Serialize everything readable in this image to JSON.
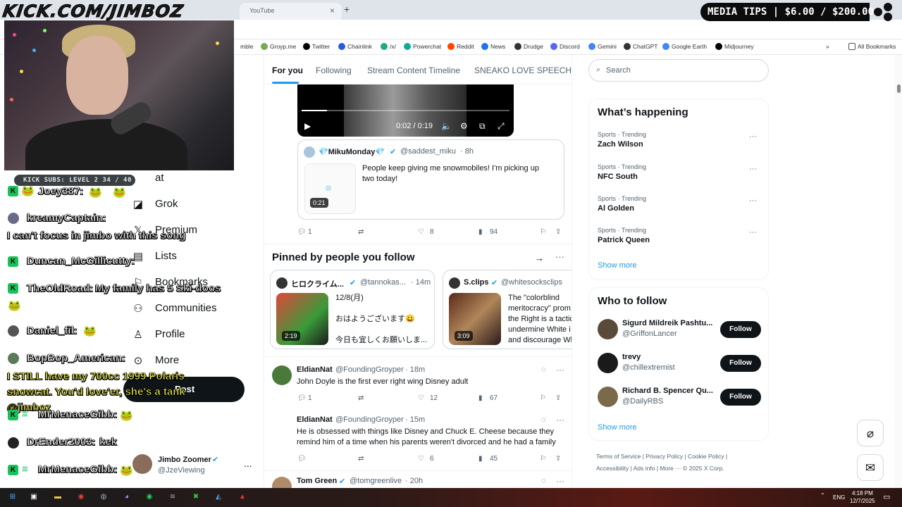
{
  "overlay": {
    "kick_url": "KICK.COM/JIMBOZ",
    "subs_goal": "KICK SUBS: LEVEL 2 34 / 40",
    "media_tips": "MEDIA TIPS | $6.00 / $200.00"
  },
  "browser": {
    "tab_title": "YouTube",
    "tab_close": "×",
    "new_tab": "+",
    "bookmarks": [
      "Groyp.me",
      "Twitter",
      "Chainlink",
      "/x/",
      "Powerchat",
      "Reddit",
      "News",
      "Drudge",
      "Discord",
      "Gemini",
      "ChatGPT",
      "Google Earth",
      "Midjourney"
    ],
    "bookmark_first_partial": "mble",
    "bookmarks_overflow": "»",
    "all_bookmarks": "All Bookmarks"
  },
  "chat": [
    {
      "user": "Joey387:",
      "text": ""
    },
    {
      "user": "kreamyCaptain:",
      "text": "I can't focus in jimbo with this song"
    },
    {
      "user": "Duncan_McGillicutty:",
      "text": ""
    },
    {
      "user": "TheOldRoad:",
      "text": "My family has 5 Ski-doos"
    },
    {
      "user": "Daniel_fil:",
      "text": ""
    },
    {
      "user": "BopBop_American:",
      "text": "I STILL have my 700cc 1999 Polaris snowcat. You'd love'er, she's a tank @jimboz"
    },
    {
      "user": "MrMenaceGibb:",
      "text": ""
    },
    {
      "user": "DrEnder2003:",
      "text": "kek"
    },
    {
      "user": "MrMenaceGibb:",
      "text": ""
    }
  ],
  "nav": {
    "items": [
      {
        "icon": "grok-icon",
        "label": "Grok"
      },
      {
        "icon": "x-premium-icon",
        "label": "Premium"
      },
      {
        "icon": "lists-icon",
        "label": "Lists"
      },
      {
        "icon": "bookmark-icon",
        "label": "Bookmarks"
      },
      {
        "icon": "communities-icon",
        "label": "Communities"
      },
      {
        "icon": "profile-icon",
        "label": "Profile"
      },
      {
        "icon": "more-icon",
        "label": "More"
      }
    ],
    "partial_item": "at",
    "post_button": "Post",
    "account": {
      "name": "Jimbo Zoomer",
      "handle": "@JzeViewing",
      "more": "..."
    }
  },
  "timeline": {
    "tabs": [
      "For you",
      "Following",
      "Stream Content Timeline",
      "SNEAKO LOVE SPEECH"
    ],
    "video": {
      "time": "0:02 / 0:19"
    },
    "quote": {
      "name": "💎MikuMonday💎",
      "handle": "@saddest_miku",
      "time": "· 8h",
      "duration": "0:21",
      "text": "People keep giving me snowmobiles! I'm picking up two today!"
    },
    "actions1": {
      "replies": "1",
      "likes": "8",
      "views": "94"
    },
    "pinned": {
      "title": "Pinned by people you follow",
      "cards": [
        {
          "name": "ヒロクライム...",
          "handle": "@tannokas...",
          "time": "· 14m",
          "duration": "2:19",
          "lines": [
            "12/8(月)",
            "おはようございます😀",
            "今日も宜しくお願いしま..."
          ]
        },
        {
          "name": "S.clips",
          "handle": "@whitesocksclips",
          "time": "·",
          "duration": "3:09",
          "lines": [
            "The \"colorblind",
            "meritocracy\" prom",
            "the Right is a tactic",
            "undermine White i",
            "and discourage Wh"
          ]
        }
      ]
    },
    "tweets": [
      {
        "name": "EldianNat",
        "handle": "@FoundingGroyper",
        "time": "· 18m",
        "text": "John Doyle is the first ever right wing Disney adult",
        "replies": "1",
        "likes": "12",
        "views": "67"
      },
      {
        "name": "EldianNat",
        "handle": "@FoundingGroyper",
        "time": "· 15m",
        "text": "He is obsessed with things like Disney and Chuck E. Cheese because they remind him of a time when his parents weren't divorced and he had a family",
        "replies": "",
        "likes": "6",
        "views": "45"
      },
      {
        "name": "Tom Green",
        "handle": "@tomgreenlive",
        "time": "· 20h",
        "text": "",
        "replies": "",
        "likes": "",
        "views": ""
      }
    ]
  },
  "sidebar": {
    "search_placeholder": "Search",
    "happening_title": "What’s happening",
    "trends": [
      {
        "meta": "Sports · Trending",
        "topic": "Zach Wilson"
      },
      {
        "meta": "Sports · Trending",
        "topic": "NFC South"
      },
      {
        "meta": "Sports · Trending",
        "topic": "Al Golden"
      },
      {
        "meta": "Sports · Trending",
        "topic": "Patrick Queen"
      }
    ],
    "show_more": "Show more",
    "wtf_title": "Who to follow",
    "follow": [
      {
        "name": "Sigurd Mildreik Pashtu...",
        "handle": "@GriffonLancer",
        "button": "Follow"
      },
      {
        "name": "trevy",
        "handle": "@chillextremist",
        "button": "Follow"
      },
      {
        "name": "Richard B. Spencer Qu...",
        "handle": "@DailyRBS",
        "button": "Follow"
      }
    ],
    "footer_line1": "Terms of Service  |  Privacy Policy  |  Cookie Policy  |",
    "footer_line2": "Accessibility  |  Ads info  |  More ···  © 2025 X Corp."
  },
  "taskbar": {
    "lang": "ENG",
    "time": "4:18 PM",
    "date": "12/7/2025"
  },
  "colors": {
    "accent": "#1d9bf0",
    "text": "#0f1419",
    "muted": "#536471",
    "kick_green": "#16c35a"
  }
}
